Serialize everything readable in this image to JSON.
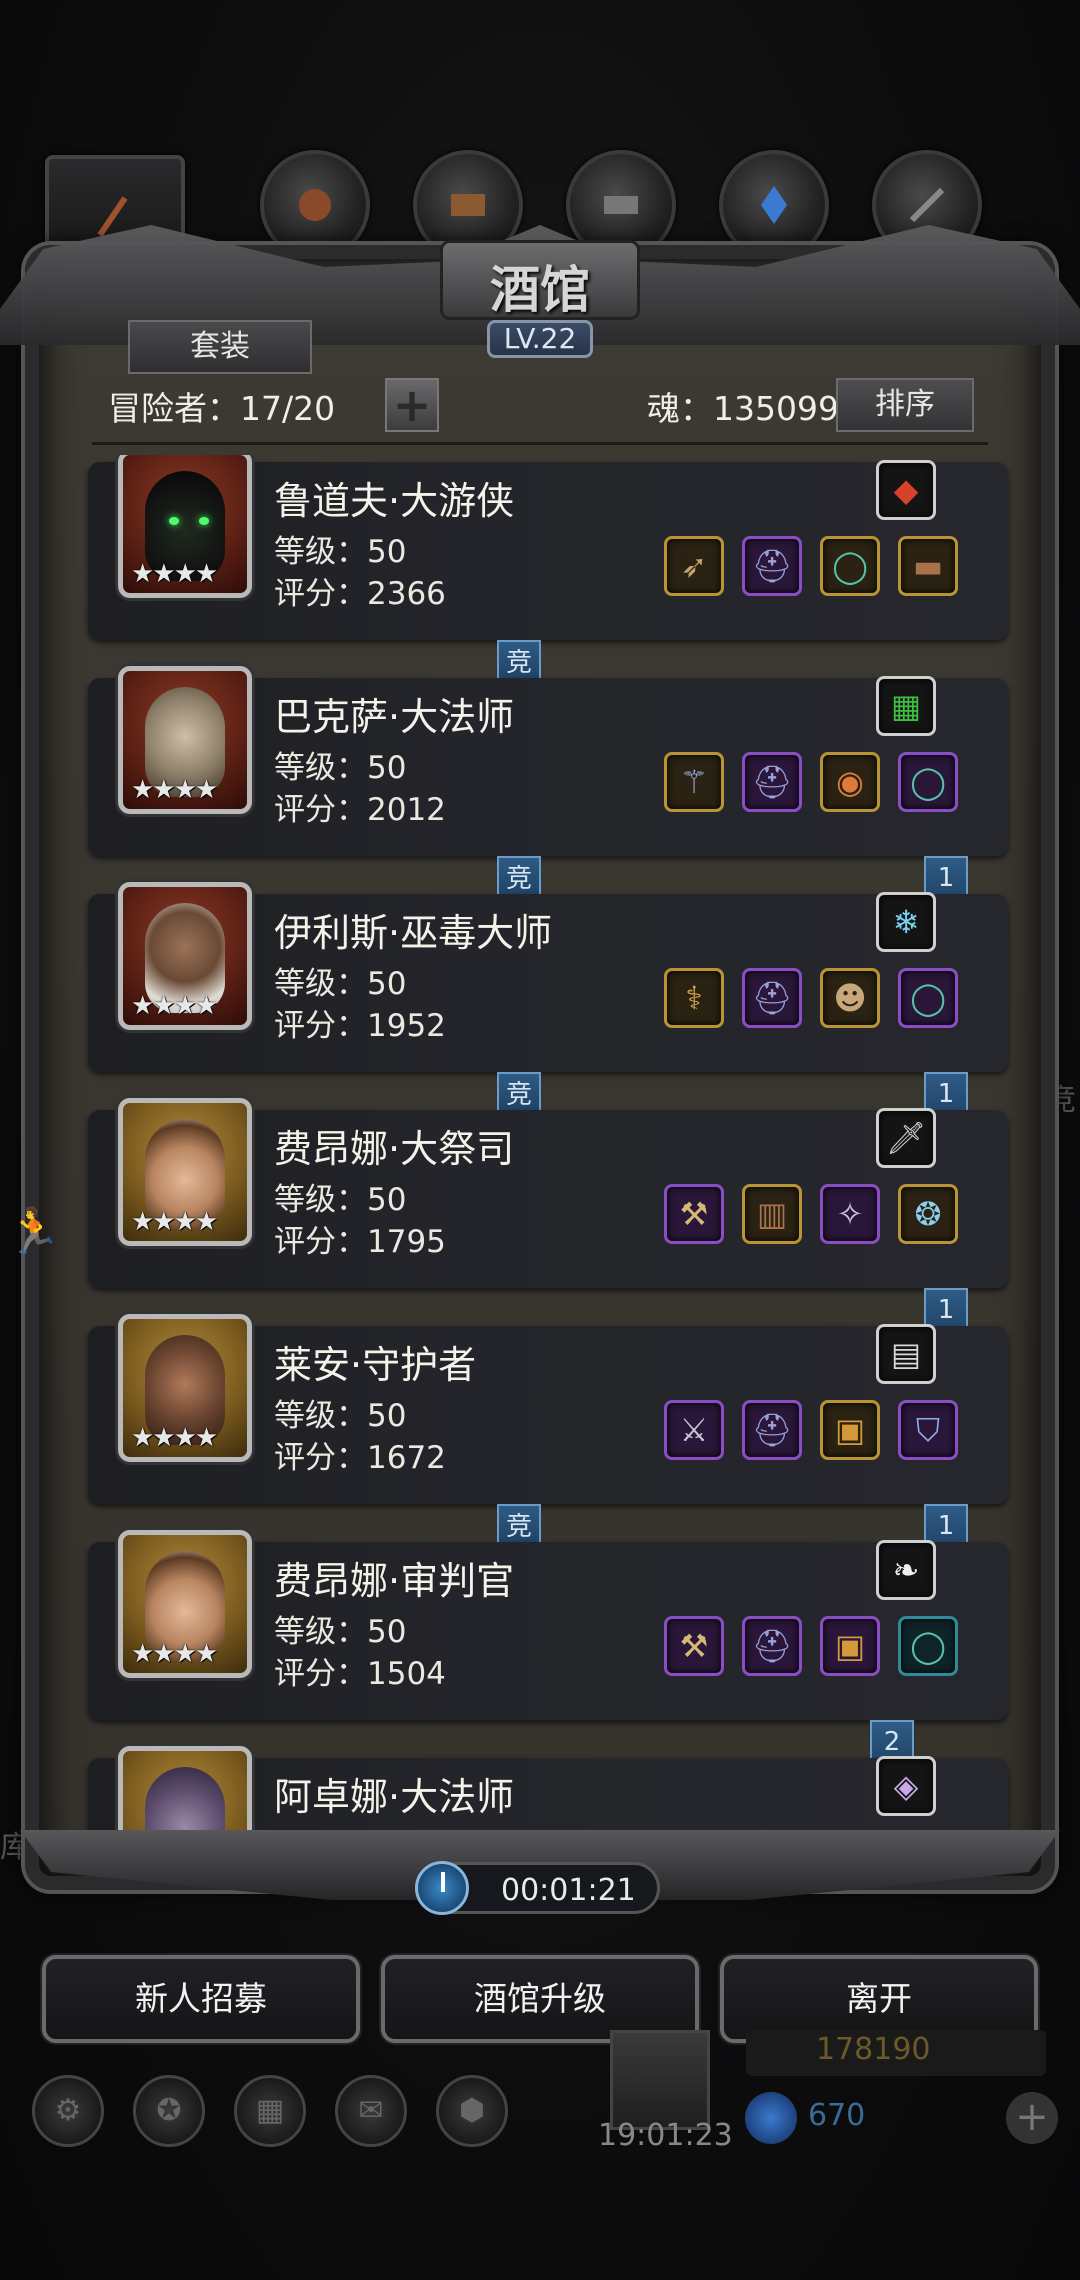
{
  "header": {
    "title": "酒馆",
    "level": "LV.22",
    "set_button": "套装",
    "roster": "冒险者：17/20",
    "add": "+",
    "soul": "魂：135099",
    "sort_button": "排序"
  },
  "heroes": [
    {
      "name": "鲁道夫·大游侠",
      "level": "等级：50",
      "score": "评分：2366",
      "stars": "★★★★",
      "portrait_frame": "red",
      "top_item": {
        "icon": "red-gem",
        "glyph": "◆",
        "color": "#d8412a",
        "frame": "white"
      },
      "items": [
        {
          "icon": "bow",
          "glyph": "➶",
          "color": "#c7a36a",
          "frame": "gold"
        },
        {
          "icon": "helmet",
          "glyph": "⛑",
          "color": "#9aa0d8",
          "frame": "purple"
        },
        {
          "icon": "ring",
          "glyph": "◯",
          "color": "#56c2a8",
          "frame": "gold"
        },
        {
          "icon": "bracer",
          "glyph": "▬",
          "color": "#a8724a",
          "frame": "gold"
        }
      ],
      "tag": "竞",
      "rank": ""
    },
    {
      "name": "巴克萨·大法师",
      "level": "等级：50",
      "score": "评分：2012",
      "stars": "★★★★",
      "portrait_frame": "red",
      "top_item": {
        "icon": "green-tome",
        "glyph": "▦",
        "color": "#3fbf3f",
        "frame": "white"
      },
      "items": [
        {
          "icon": "staff",
          "glyph": "⚚",
          "color": "#9ab0e0",
          "frame": "gold"
        },
        {
          "icon": "helmet",
          "glyph": "⛑",
          "color": "#9aa0d8",
          "frame": "purple"
        },
        {
          "icon": "amulet",
          "glyph": "◉",
          "color": "#e07a3a",
          "frame": "gold"
        },
        {
          "icon": "ring",
          "glyph": "◯",
          "color": "#56c2a8",
          "frame": "purple"
        }
      ],
      "tag": "竞",
      "rank": "1"
    },
    {
      "name": "伊利斯·巫毒大师",
      "level": "等级：50",
      "score": "评分：1952",
      "stars": "★★★★",
      "portrait_frame": "red",
      "top_item": {
        "icon": "ice-shard",
        "glyph": "❄",
        "color": "#7ad0f0",
        "frame": "white"
      },
      "items": [
        {
          "icon": "staff",
          "glyph": "⚕",
          "color": "#d4a64a",
          "frame": "gold"
        },
        {
          "icon": "helmet",
          "glyph": "⛑",
          "color": "#9aa0d8",
          "frame": "purple"
        },
        {
          "icon": "mask",
          "glyph": "☻",
          "color": "#c8a87a",
          "frame": "gold"
        },
        {
          "icon": "ring",
          "glyph": "◯",
          "color": "#56c2a8",
          "frame": "purple"
        }
      ],
      "tag": "竞",
      "rank": "1"
    },
    {
      "name": "费昂娜·大祭司",
      "level": "等级：50",
      "score": "评分：1795",
      "stars": "★★★★",
      "portrait_frame": "gold",
      "top_item": {
        "icon": "dagger",
        "glyph": "🗡",
        "color": "#cfcfcf",
        "frame": "white"
      },
      "items": [
        {
          "icon": "hammer",
          "glyph": "⚒",
          "color": "#d8b878",
          "frame": "purple"
        },
        {
          "icon": "armor",
          "glyph": "▥",
          "color": "#a8724a",
          "frame": "gold"
        },
        {
          "icon": "necklace",
          "glyph": "✧",
          "color": "#c8c8e8",
          "frame": "purple"
        },
        {
          "icon": "crystal-ring",
          "glyph": "❂",
          "color": "#8ad0f0",
          "frame": "gold"
        }
      ],
      "tag": "",
      "rank": "1"
    },
    {
      "name": "莱安·守护者",
      "level": "等级：50",
      "score": "评分：1672",
      "stars": "★★★★",
      "portrait_frame": "gold",
      "top_item": {
        "icon": "gauntlet",
        "glyph": "▤",
        "color": "#d8d8d8",
        "frame": "white"
      },
      "items": [
        {
          "icon": "sword",
          "glyph": "⚔",
          "color": "#c8c8d8",
          "frame": "purple"
        },
        {
          "icon": "helmet",
          "glyph": "⛑",
          "color": "#9aa0d8",
          "frame": "purple"
        },
        {
          "icon": "chest-armor",
          "glyph": "▣",
          "color": "#d49a3a",
          "frame": "gold"
        },
        {
          "icon": "shield",
          "glyph": "⛉",
          "color": "#8ab0e8",
          "frame": "purple"
        }
      ],
      "tag": "竞",
      "rank": "1"
    },
    {
      "name": "费昂娜·审判官",
      "level": "等级：50",
      "score": "评分：1504",
      "stars": "★★★★",
      "portrait_frame": "gold",
      "top_item": {
        "icon": "feather",
        "glyph": "❧",
        "color": "#f0f0f0",
        "frame": "white"
      },
      "items": [
        {
          "icon": "hammer",
          "glyph": "⚒",
          "color": "#d8b878",
          "frame": "purple"
        },
        {
          "icon": "helmet",
          "glyph": "⛑",
          "color": "#9aa0d8",
          "frame": "purple"
        },
        {
          "icon": "chest-armor",
          "glyph": "▣",
          "color": "#d49a3a",
          "frame": "purple"
        },
        {
          "icon": "ring",
          "glyph": "◯",
          "color": "#56c2a8",
          "frame": "teal"
        }
      ],
      "tag": "",
      "rank": "2"
    },
    {
      "name": "阿卓娜·大法师",
      "level": "",
      "score": "",
      "stars": "",
      "portrait_frame": "gold",
      "top_item": {
        "icon": "crystal",
        "glyph": "◈",
        "color": "#c8a8e8",
        "frame": "white"
      },
      "items": [],
      "tag": "",
      "rank": ""
    }
  ],
  "timer": "00:01:21",
  "actions": {
    "recruit": "新人招募",
    "upgrade": "酒馆升级",
    "leave": "离开"
  },
  "background": {
    "side_text_right": "竞",
    "side_text_left": "库",
    "time": "19:01:23",
    "gold": "178190",
    "gems": "670"
  }
}
